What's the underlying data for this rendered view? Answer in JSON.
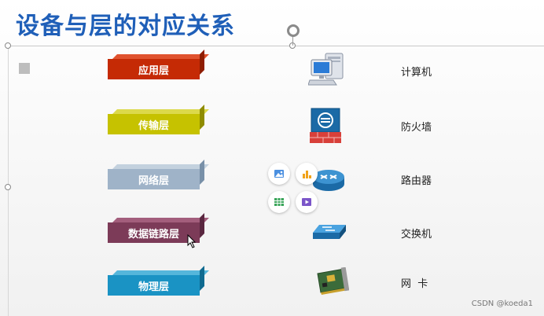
{
  "title": "设备与层的对应关系",
  "layers": [
    {
      "label": "应用层",
      "color": "#c52a05",
      "top": "#e0522e",
      "side": "#8f1d02"
    },
    {
      "label": "传输层",
      "color": "#c6c200",
      "top": "#dcd94a",
      "side": "#8f8c00"
    },
    {
      "label": "网络层",
      "color": "#9fb3c8",
      "top": "#c3d1de",
      "side": "#7890a8"
    },
    {
      "label": "数据链路层",
      "color": "#7c3b58",
      "top": "#a35e7c",
      "side": "#5a2740"
    },
    {
      "label": "物理层",
      "color": "#1a93c4",
      "top": "#55b6db",
      "side": "#0f6a90"
    }
  ],
  "devices": [
    {
      "label": "计算机",
      "icon": "computer-icon"
    },
    {
      "label": "防火墙",
      "icon": "firewall-icon"
    },
    {
      "label": "路由器",
      "icon": "router-icon"
    },
    {
      "label": "交换机",
      "icon": "switch-icon"
    },
    {
      "label": "网  卡",
      "icon": "network-card-icon"
    }
  ],
  "quick_insert": [
    "image-icon",
    "chart-icon",
    "table-icon",
    "video-icon"
  ],
  "watermark": "CSDN @koeda1"
}
